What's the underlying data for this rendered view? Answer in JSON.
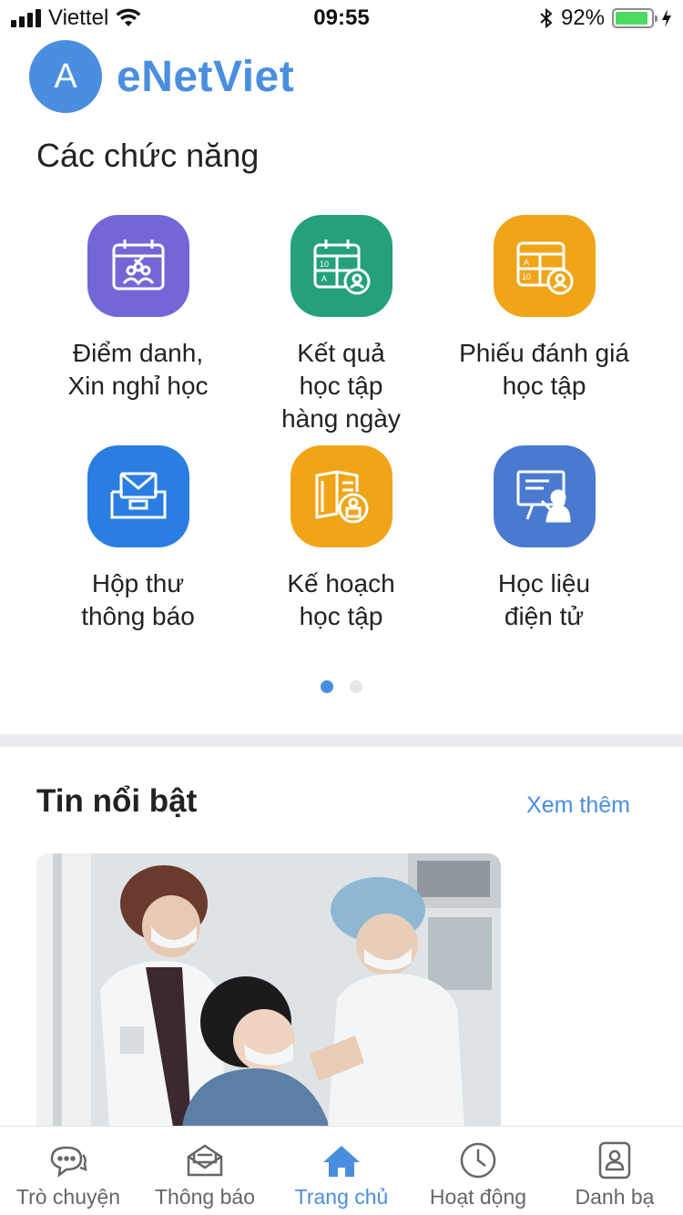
{
  "status_bar": {
    "carrier": "Viettel",
    "time": "09:55",
    "battery_percent": "92%",
    "battery_level": 0.92
  },
  "header": {
    "avatar_letter": "A",
    "app_title": "eNetViet"
  },
  "features_section": {
    "title": "Các chức năng",
    "items": [
      {
        "lines": [
          "Điểm danh,",
          "Xin nghỉ học"
        ],
        "color": "#7367d8",
        "icon": "calendar-attendance-icon"
      },
      {
        "lines": [
          "Kết quả",
          "học tập",
          "hàng ngày"
        ],
        "color": "#24a17c",
        "icon": "calendar-grades-icon"
      },
      {
        "lines": [
          "Phiếu đánh giá",
          "học tập"
        ],
        "color": "#f0a519",
        "icon": "report-card-icon"
      },
      {
        "lines": [
          "Hộp thư",
          "thông báo"
        ],
        "color": "#2a7de1",
        "icon": "inbox-icon"
      },
      {
        "lines": [
          "Kế hoạch",
          "học tập"
        ],
        "color": "#f0a519",
        "icon": "study-plan-book-icon"
      },
      {
        "lines": [
          "Học liệu",
          "điện tử"
        ],
        "color": "#4a7ad0",
        "icon": "e-learning-board-icon"
      }
    ],
    "page_count": 2,
    "current_page": 1
  },
  "news_section": {
    "title": "Tin nổi bật",
    "see_more": "Xem thêm"
  },
  "tab_bar": {
    "tabs": [
      {
        "label": "Trò chuyện",
        "icon": "chat-bubbles-icon"
      },
      {
        "label": "Thông báo",
        "icon": "envelope-icon"
      },
      {
        "label": "Trang chủ",
        "icon": "home-icon",
        "active": true
      },
      {
        "label": "Hoạt động",
        "icon": "clock-icon"
      },
      {
        "label": "Danh bạ",
        "icon": "contacts-icon"
      }
    ],
    "active_color": "#4a8ee0"
  }
}
